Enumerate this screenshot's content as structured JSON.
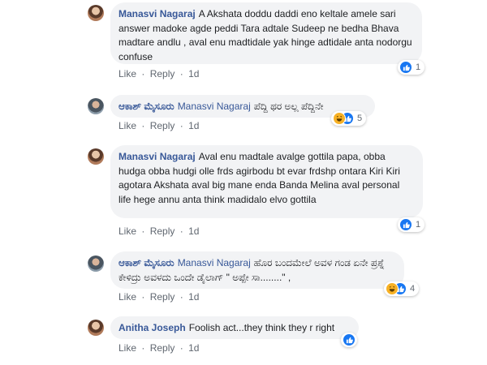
{
  "actions": {
    "like": "Like",
    "reply": "Reply",
    "sep": "·"
  },
  "comments": [
    {
      "author": "Manasvi Nagaraj",
      "text": "A Akshata doddu daddi eno keltale amele sari answer madoke agde peddi Tara adtale Sudeep ne bedha Bhava madtare andlu , aval enu madtidale yak hinge adtidale anta nodorgu confuse",
      "time": "1d",
      "reaction_count": "1",
      "reactions": [
        "like-icon"
      ]
    },
    {
      "author": "ಆಕಾಶ್ ಮೈಸೂರು",
      "tag": "Manasvi Nagaraj",
      "text": "ಪೆದ್ದಿ ಥರ ಅಲ್ಲ ಪೆದ್ದಿನೇ",
      "time": "1d",
      "reaction_count": "5",
      "reactions": [
        "haha-icon",
        "like-icon"
      ]
    },
    {
      "author": "Manasvi Nagaraj",
      "text": "Aval enu madtale avalge gottila papa, obba hudga obba hudgi olle frds agirbodu bt evar frdshp ontara Kiri Kiri agotara Akshata aval big mane enda Banda Melina aval personal life hege annu anta think madidalo elvo gottila",
      "time": "1d",
      "reaction_count": "1",
      "reactions": [
        "like-icon"
      ]
    },
    {
      "author": "ಆಕಾಶ್ ಮೈಸೂರು",
      "tag": "Manasvi Nagaraj",
      "text": "ಹೊರ ಬಂದಮೇಲೆ ಅವಳ ಗಂಡ ಏನೇ ಪ್ರಶ್ನೆ ಕೇಳಿದ್ರು ಅವಳದು ಒಂದೇ ಡೈಲಾಗ್ \" ಅಪ್ಪೇ ಸಾ........\" ,",
      "time": "1d",
      "reaction_count": "4",
      "reactions": [
        "haha-icon",
        "like-icon"
      ]
    },
    {
      "author": "Anitha Joseph",
      "text": "Foolish act...they think they r right",
      "time": "1d",
      "reaction_count": "",
      "reactions": [
        "like-icon"
      ]
    }
  ]
}
